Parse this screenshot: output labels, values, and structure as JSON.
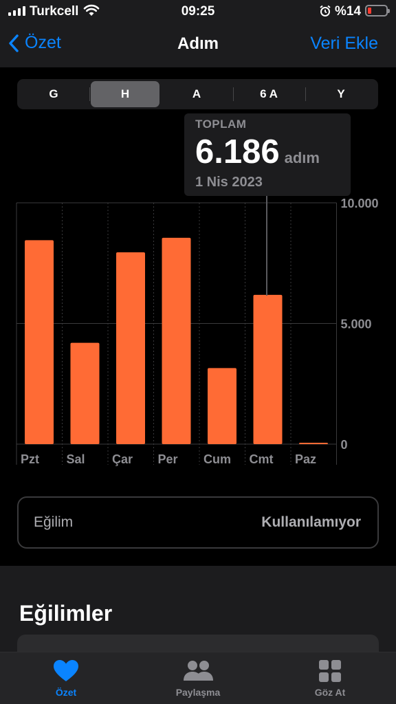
{
  "status_bar": {
    "carrier": "Turkcell",
    "time": "09:25",
    "battery": "%14",
    "icons": [
      "signal-icon",
      "wifi-icon",
      "alarm-icon",
      "battery-icon"
    ]
  },
  "nav": {
    "back_label": "Özet",
    "title": "Adım",
    "action_label": "Veri Ekle"
  },
  "segments": {
    "items": [
      "G",
      "H",
      "A",
      "6 A",
      "Y"
    ],
    "selected": "H"
  },
  "tooltip": {
    "heading": "TOPLAM",
    "value": "6.186",
    "unit": "adım",
    "date": "1 Nis 2023"
  },
  "chart_data": {
    "type": "bar",
    "categories": [
      "Pzt",
      "Sal",
      "Çar",
      "Per",
      "Cum",
      "Cmt",
      "Paz"
    ],
    "values": [
      8450,
      4200,
      7950,
      8550,
      3150,
      6186,
      40
    ],
    "ylim": [
      0,
      10000
    ],
    "y_ticks": [
      0,
      5000,
      10000
    ],
    "y_tick_labels": [
      "0",
      "5.000",
      "10.000"
    ],
    "bar_color": "#ff6b35",
    "selected_category": "Cmt",
    "grid": true
  },
  "trend": {
    "label": "Eğilim",
    "value": "Kullanılamıyor"
  },
  "trends_section": {
    "title": "Eğilimler"
  },
  "tabbar": {
    "tabs": [
      {
        "label": "Özet",
        "icon": "heart-icon",
        "active": true
      },
      {
        "label": "Paylaşma",
        "icon": "people-icon",
        "active": false
      },
      {
        "label": "Göz At",
        "icon": "grid-icon",
        "active": false
      }
    ]
  },
  "colors": {
    "accent": "#0a84ff",
    "bar": "#ff6b35",
    "background": "#000000",
    "surface": "#1c1c1e"
  }
}
